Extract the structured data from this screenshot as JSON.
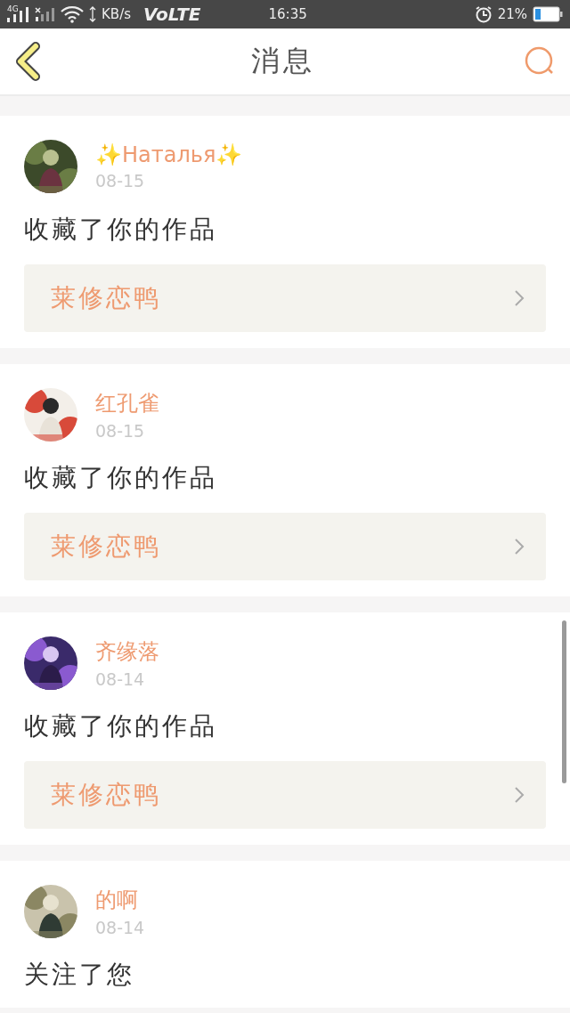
{
  "status_bar": {
    "network_type": "4G",
    "network_speed": "KB/s",
    "volte": "VoLTE",
    "time": "16:35",
    "battery_percent": "21%"
  },
  "header": {
    "title": "消息"
  },
  "messages": [
    {
      "kind": "work",
      "user": "✨Наталья✨",
      "date": "08-15",
      "action": "收藏了你的作品",
      "work_title": "莱修恋鸭"
    },
    {
      "kind": "work",
      "user": "红孔雀",
      "date": "08-15",
      "action": "收藏了你的作品",
      "work_title": "莱修恋鸭"
    },
    {
      "kind": "work",
      "user": "齐缘落",
      "date": "08-14",
      "action": "收藏了你的作品",
      "work_title": "莱修恋鸭"
    },
    {
      "kind": "follow",
      "user": "的啊",
      "date": "08-14",
      "action": "关注了您"
    }
  ]
}
